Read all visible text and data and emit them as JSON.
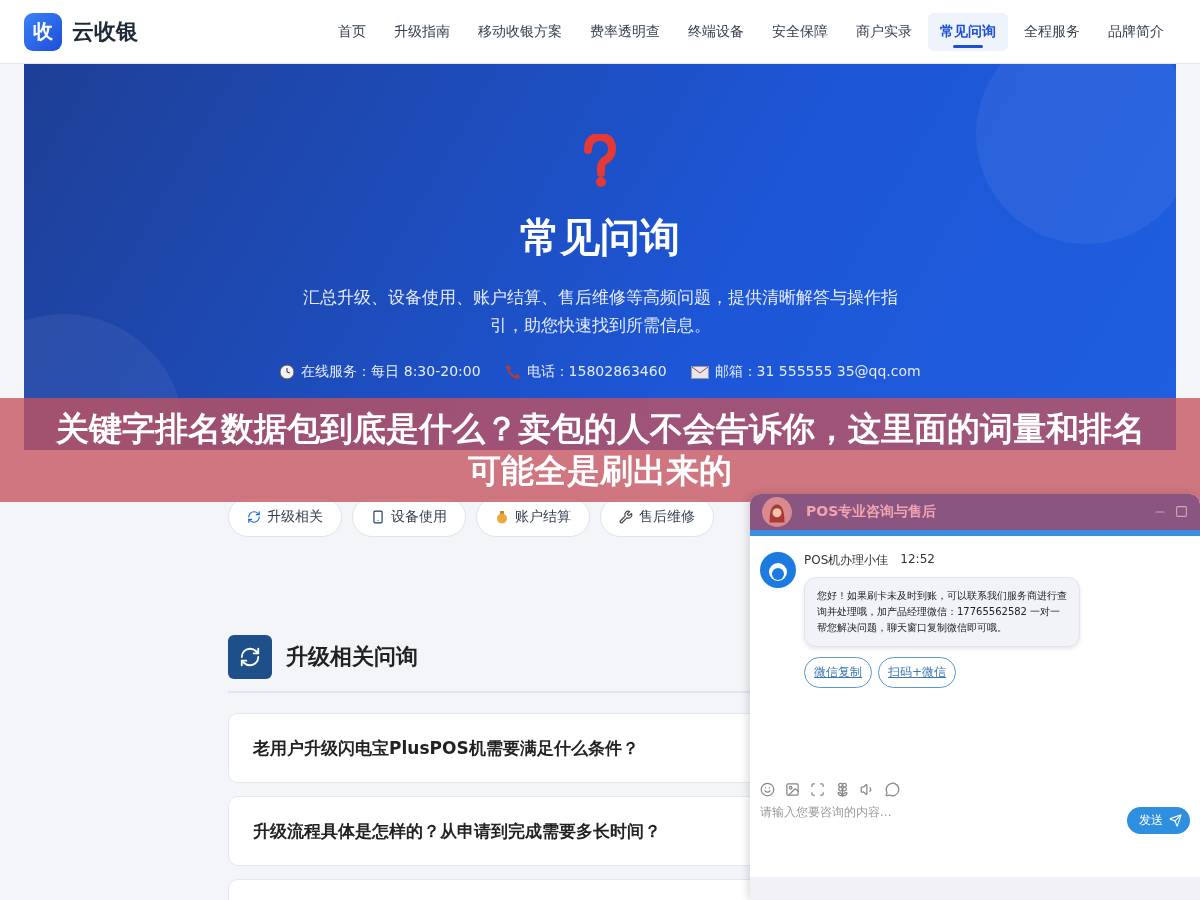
{
  "brand": {
    "logo_char": "收",
    "name": "云收银"
  },
  "nav": [
    {
      "label": "首页",
      "selected": false
    },
    {
      "label": "升级指南",
      "selected": false
    },
    {
      "label": "移动收银方案",
      "selected": false
    },
    {
      "label": "费率透明查",
      "selected": false
    },
    {
      "label": "终端设备",
      "selected": false
    },
    {
      "label": "安全保障",
      "selected": false
    },
    {
      "label": "商户实录",
      "selected": false
    },
    {
      "label": "常见问询",
      "selected": true
    },
    {
      "label": "全程服务",
      "selected": false
    },
    {
      "label": "品牌简介",
      "selected": false
    }
  ],
  "hero": {
    "title": "常见问询",
    "subtitle": "汇总升级、设备使用、账户结算、售后维修等高频问题，提供清晰解答与操作指引，助您快速找到所需信息。",
    "contacts": [
      {
        "kind": "clock",
        "text": "在线服务：每日 8:30-20:00"
      },
      {
        "kind": "phone",
        "text": "电话：15802863460"
      },
      {
        "kind": "mail",
        "text": "邮箱：31 555555 35@qq.com"
      }
    ]
  },
  "banner": {
    "text": "关键字排名数据包到底是什么？卖包的人不会告诉你，这里面的词量和排名可能全是刷出来的"
  },
  "categories": [
    {
      "kind": "refresh",
      "label": "升级相关"
    },
    {
      "kind": "device",
      "label": "设备使用"
    },
    {
      "kind": "money",
      "label": "账户结算"
    },
    {
      "kind": "wrench",
      "label": "售后维修"
    }
  ],
  "section": {
    "title": "升级相关问询",
    "questions": [
      "老用户升级闪电宝PlusPOS机需要满足什么条件？",
      "升级流程具体是怎样的？从申请到完成需要多长时间？"
    ]
  },
  "chat": {
    "title": "POS专业咨询与售后",
    "agent": "POS机办理小佳",
    "time": "12:52",
    "message": "您好！如果刷卡未及时到账，可以联系我们服务商进行查询并处理哦，加产品经理微信：17765562582 一对一帮您解决问题，聊天窗口复制微信即可哦。",
    "actions": [
      "微信复制",
      "扫码+微信"
    ],
    "placeholder": "请输入您要咨询的内容...",
    "send": "发送"
  }
}
